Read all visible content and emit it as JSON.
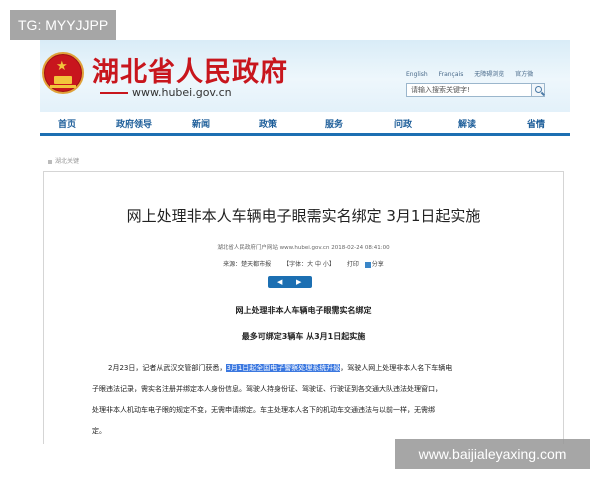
{
  "watermark_top": "TG: MYYJJPP",
  "watermark_bottom": "www.baijialeyaxing.com",
  "site": {
    "title": "湖北省人民政府",
    "url": "www.hubei.gov.cn",
    "top_links": [
      "English",
      "Français",
      "无障碍浏览",
      "官方微"
    ],
    "search_placeholder": "请输入搜索关键字!"
  },
  "nav": {
    "items": [
      "首页",
      "政府领导",
      "新闻",
      "政策",
      "服务",
      "问政",
      "解读",
      "省情"
    ]
  },
  "breadcrumb": "湖北关键",
  "article": {
    "headline": "网上处理非本人车辆电子眼需实名绑定 3月1日起实施",
    "meta": "湖北省人民政府门户网站 www.hubei.gov.cn 2018-02-24 08:41:00",
    "source": "来源：楚天都市报",
    "font_size_label": "【字体：大 中 小】",
    "print_label": "打印",
    "share_label": "分享",
    "subtitle1": "网上处理非本人车辆电子眼需实名绑定",
    "subtitle2": "最多可绑定3辆车 从3月1日起实施",
    "line1_before": "2月23日，记者从武汉交管部门获悉，",
    "line1_highlight": "3月1日起全国电子警察处理系统升级",
    "line1_after": "，驾驶人网上处理非本人名下车辆电",
    "line2": "子眼违法记录，需实名注册并绑定本人身份信息。驾驶人持身份证、驾驶证、行驶证到各交通大队违法处理窗口，",
    "line3": "处理非本人机动车电子眼的规定不变，无需申请绑定。车主处理本人名下的机动车交通违法与以前一样，无需绑",
    "line4": "定。"
  },
  "colors": {
    "brand_red": "#c8161d",
    "nav_blue": "#1c6fb2",
    "highlight": "#3b78e0"
  }
}
